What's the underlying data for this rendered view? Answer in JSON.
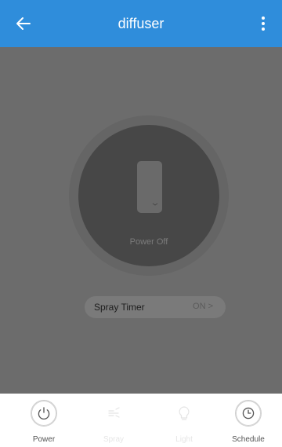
{
  "header": {
    "title": "diffuser",
    "back_icon": "arrow-left-icon",
    "menu_icon": "more-vertical-icon",
    "color": "#2f8ddb"
  },
  "device": {
    "status_label": "Power Off",
    "icon": "device-icon"
  },
  "spray_timer": {
    "label": "Spray Timer",
    "state": "ON >"
  },
  "tabs": [
    {
      "label": "Power",
      "icon": "power-icon",
      "enabled": true
    },
    {
      "label": "Spray",
      "icon": "spray-icon",
      "enabled": false
    },
    {
      "label": "Light",
      "icon": "bulb-icon",
      "enabled": false
    },
    {
      "label": "Schedule",
      "icon": "clock-icon",
      "enabled": true
    }
  ],
  "colors": {
    "overlay": "#6c6c6c",
    "dial": "#474747"
  }
}
